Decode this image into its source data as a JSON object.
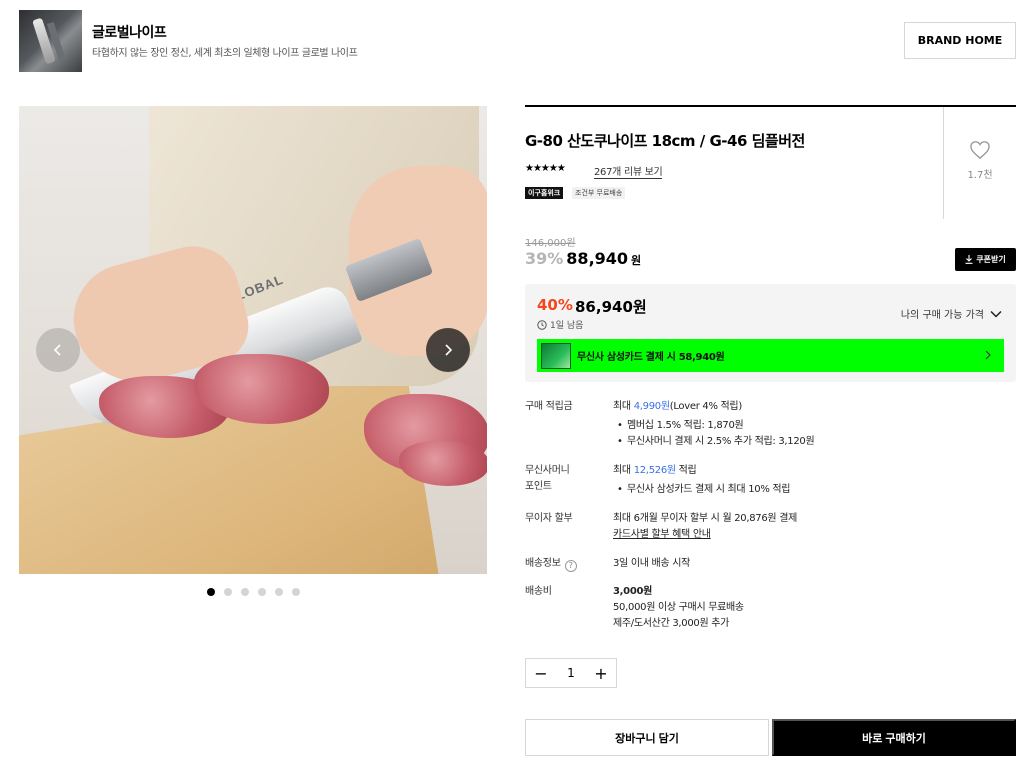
{
  "brand": {
    "name": "글로벌나이프",
    "description": "타협하지 않는 장인 정신, 세계 최초의 일체형 나이프 글로벌 나이프",
    "home_button": "BRAND HOME"
  },
  "gallery": {
    "image_alt": "GLOBAL G-80 knife cutting meat on wooden board",
    "knife_brand_text": "GLOBAL",
    "dot_count": 6,
    "active_dot": 0
  },
  "product": {
    "title": "G-80 산도쿠나이프 18cm / G-46 딤플버전",
    "rating_stars": "★★★★★",
    "review_link": "267개 리뷰 보기",
    "badges": [
      "이구홈위크",
      "조건부 무료배송"
    ],
    "like_count": "1.7천"
  },
  "price": {
    "original": "146,000원",
    "discount_pct": "39%",
    "sale_price": "88,940",
    "won": "원",
    "coupon_button": "쿠폰받기"
  },
  "my_price": {
    "discount_pct": "40%",
    "price": "86,940원",
    "time_left": "1일 남음",
    "label": "나의 구매 가능 가격",
    "card_banner": "무신사 삼성카드 결제 시 58,940원",
    "banner_color": "#00ff00"
  },
  "details": {
    "points": {
      "label": "구매 적립금",
      "main_prefix": "최대 ",
      "main_amount": "4,990원",
      "main_suffix": "(Lover 4% 적립)",
      "sub1": "멤버십 1.5% 적립: 1,870원",
      "sub2": "무신사머니 결제 시 2.5% 추가 적립: 3,120원"
    },
    "money": {
      "label1": "무신사머니",
      "label2": "포인트",
      "main_prefix": "최대 ",
      "main_amount": "12,526원",
      "main_suffix": " 적립",
      "sub1": "무신사 삼성카드 결제 시 최대 10% 적립"
    },
    "installment": {
      "label": "무이자 할부",
      "line1": "최대 6개월 무이자 할부 시 월 20,876원 결제",
      "link": "카드사별 할부 혜택 안내"
    },
    "shipping": {
      "label": "배송정보",
      "value": "3일 이내 배송 시작"
    },
    "shipping_fee": {
      "label": "배송비",
      "amount": "3,000원",
      "line2": "50,000원 이상 구매시 무료배송",
      "line3": "제주/도서산간 3,000원 추가"
    }
  },
  "quantity": {
    "minus": "−",
    "value": "1",
    "plus": "+"
  },
  "actions": {
    "cart": "장바구니 담기",
    "buy": "바로 구매하기"
  }
}
